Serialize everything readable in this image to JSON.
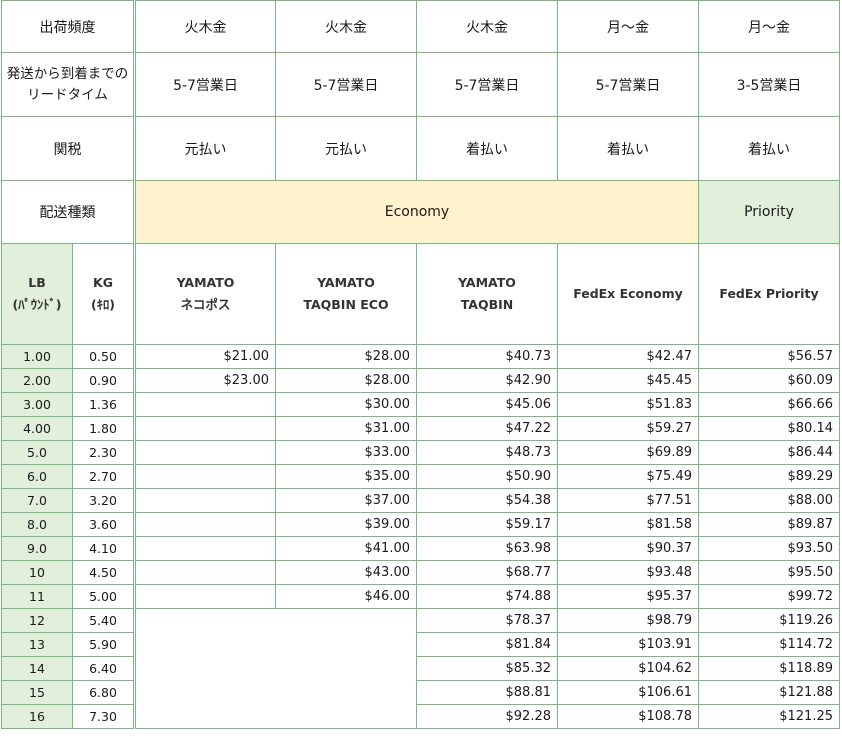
{
  "header_rows": {
    "frequency": {
      "label": "出荷頻度",
      "values": [
        "火木金",
        "火木金",
        "火木金",
        "月～金",
        "月～金"
      ]
    },
    "lead_time": {
      "label_line1": "発送から到着までの",
      "label_line2": "リードタイム",
      "values": [
        "5-7営業日",
        "5-7営業日",
        "5-7営業日",
        "5-7営業日",
        "3-5営業日"
      ]
    },
    "duty": {
      "label": "関税",
      "values": [
        "元払い",
        "元払い",
        "着払い",
        "着払い",
        "着払い"
      ]
    },
    "shipping_type": {
      "label": "配送種類",
      "economy": "Economy",
      "priority": "Priority"
    }
  },
  "column_headers": {
    "lb_line1": "LB",
    "lb_line2": "(ﾊﾟｳﾝﾄﾞ)",
    "kg_line1": "KG",
    "kg_line2": "(ｷﾛ)",
    "carriers": [
      {
        "line1": "YAMATO",
        "line2": "ネコポス"
      },
      {
        "line1": "YAMATO",
        "line2": "TAQBIN ECO"
      },
      {
        "line1": "YAMATO",
        "line2": "TAQBIN"
      },
      {
        "line1": "FedEx Economy",
        "line2": ""
      },
      {
        "line1": "FedEx Priority",
        "line2": ""
      }
    ]
  },
  "rates": [
    {
      "lb": "1.00",
      "kg": "0.50",
      "nekopos": "$21.00",
      "taqbin_eco": "$28.00",
      "taqbin": "$40.73",
      "fedex_economy": "$42.47",
      "fedex_priority": "$56.57"
    },
    {
      "lb": "2.00",
      "kg": "0.90",
      "nekopos": "$23.00",
      "taqbin_eco": "$28.00",
      "taqbin": "$42.90",
      "fedex_economy": "$45.45",
      "fedex_priority": "$60.09"
    },
    {
      "lb": "3.00",
      "kg": "1.36",
      "nekopos": "",
      "taqbin_eco": "$30.00",
      "taqbin": "$45.06",
      "fedex_economy": "$51.83",
      "fedex_priority": "$66.66"
    },
    {
      "lb": "4.00",
      "kg": "1.80",
      "nekopos": "",
      "taqbin_eco": "$31.00",
      "taqbin": "$47.22",
      "fedex_economy": "$59.27",
      "fedex_priority": "$80.14"
    },
    {
      "lb": "5.0",
      "kg": "2.30",
      "nekopos": "",
      "taqbin_eco": "$33.00",
      "taqbin": "$48.73",
      "fedex_economy": "$69.89",
      "fedex_priority": "$86.44"
    },
    {
      "lb": "6.0",
      "kg": "2.70",
      "nekopos": "",
      "taqbin_eco": "$35.00",
      "taqbin": "$50.90",
      "fedex_economy": "$75.49",
      "fedex_priority": "$89.29"
    },
    {
      "lb": "7.0",
      "kg": "3.20",
      "nekopos": "",
      "taqbin_eco": "$37.00",
      "taqbin": "$54.38",
      "fedex_economy": "$77.51",
      "fedex_priority": "$88.00"
    },
    {
      "lb": "8.0",
      "kg": "3.60",
      "nekopos": "",
      "taqbin_eco": "$39.00",
      "taqbin": "$59.17",
      "fedex_economy": "$81.58",
      "fedex_priority": "$89.87"
    },
    {
      "lb": "9.0",
      "kg": "4.10",
      "nekopos": "",
      "taqbin_eco": "$41.00",
      "taqbin": "$63.98",
      "fedex_economy": "$90.37",
      "fedex_priority": "$93.50"
    },
    {
      "lb": "10",
      "kg": "4.50",
      "nekopos": "",
      "taqbin_eco": "$43.00",
      "taqbin": "$68.77",
      "fedex_economy": "$93.48",
      "fedex_priority": "$95.50"
    },
    {
      "lb": "11",
      "kg": "5.00",
      "nekopos": "",
      "taqbin_eco": "$46.00",
      "taqbin": "$74.88",
      "fedex_economy": "$95.37",
      "fedex_priority": "$99.72"
    },
    {
      "lb": "12",
      "kg": "5.40",
      "nekopos": "",
      "taqbin_eco": "",
      "taqbin": "$78.37",
      "fedex_economy": "$98.79",
      "fedex_priority": "$119.26"
    },
    {
      "lb": "13",
      "kg": "5.90",
      "nekopos": "",
      "taqbin_eco": "",
      "taqbin": "$81.84",
      "fedex_economy": "$103.91",
      "fedex_priority": "$114.72"
    },
    {
      "lb": "14",
      "kg": "6.40",
      "nekopos": "",
      "taqbin_eco": "",
      "taqbin": "$85.32",
      "fedex_economy": "$104.62",
      "fedex_priority": "$118.89"
    },
    {
      "lb": "15",
      "kg": "6.80",
      "nekopos": "",
      "taqbin_eco": "",
      "taqbin": "$88.81",
      "fedex_economy": "$106.61",
      "fedex_priority": "$121.88"
    },
    {
      "lb": "16",
      "kg": "7.30",
      "nekopos": "",
      "taqbin_eco": "",
      "taqbin": "$92.28",
      "fedex_economy": "$108.78",
      "fedex_priority": "$121.25"
    }
  ],
  "colors": {
    "border": "#79b882",
    "economy_bg": "#fff2cc",
    "priority_bg": "#e2efda",
    "lb_bg": "#e2efda"
  }
}
